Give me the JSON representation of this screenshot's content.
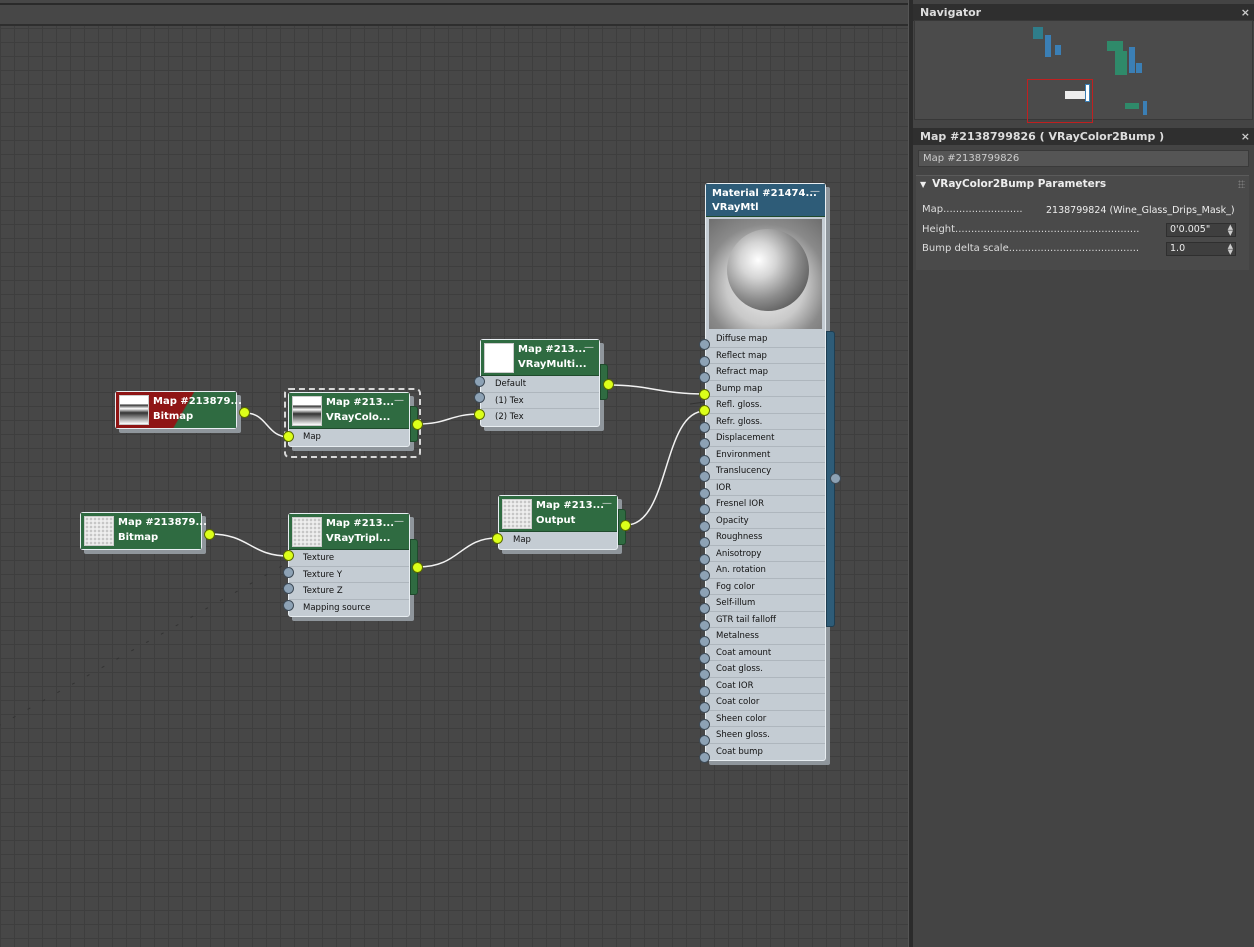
{
  "navigator": {
    "title": "Navigator",
    "close": "×"
  },
  "params_panel": {
    "title": "Map #2138799826  ( VRayColor2Bump )",
    "close": "×",
    "name_field": "Map #2138799826",
    "rollout_title": "VRayColor2Bump Parameters",
    "rollout_icon": "▼",
    "params": [
      {
        "label": "Map.........................",
        "value": "2138799824 (Wine_Glass_Drips_Mask_)"
      },
      {
        "label": "Height..........................................................",
        "value": "0'0.005\""
      },
      {
        "label": "Bump delta scale.........................................",
        "value": "1.0"
      }
    ]
  },
  "nodes": {
    "bitmap1": {
      "title": "Map #213879...",
      "type": "Bitmap"
    },
    "color2bump": {
      "title": "Map #213...",
      "type": "VRayColo...",
      "slots": [
        "Map"
      ]
    },
    "multisub": {
      "title": "Map #213...",
      "type": "VRayMulti...",
      "slots": [
        "Default",
        "(1) Tex",
        "(2) Tex"
      ]
    },
    "bitmap2": {
      "title": "Map #213879...",
      "type": "Bitmap"
    },
    "triplanar": {
      "title": "Map #213...",
      "type": "VRayTripl...",
      "slots": [
        "Texture",
        "Texture Y",
        "Texture Z",
        "Mapping source"
      ]
    },
    "output": {
      "title": "Map #213...",
      "type": "Output",
      "slots": [
        "Map"
      ]
    },
    "material": {
      "title": "Material #21474...",
      "type": "VRayMtl",
      "slots": [
        "Diffuse map",
        "Reflect map",
        "Refract map",
        "Bump map",
        "Refl. gloss.",
        "Refr. gloss.",
        "Displacement",
        "Environment",
        "Translucency",
        "IOR",
        "Fresnel IOR",
        "Opacity",
        "Roughness",
        "Anisotropy",
        "An. rotation",
        "Fog color",
        "Self-illum",
        "GTR tail falloff",
        "Metalness",
        "Coat amount",
        "Coat gloss.",
        "Coat IOR",
        "Coat color",
        "Sheen color",
        "Sheen gloss.",
        "Coat bump"
      ]
    }
  },
  "minimize_glyph": "—",
  "colors": {
    "node_green": "#2f6b41",
    "node_blue": "#2e5c78",
    "socket_active": "#dcff1a",
    "socket_idle": "#8da2b5"
  }
}
